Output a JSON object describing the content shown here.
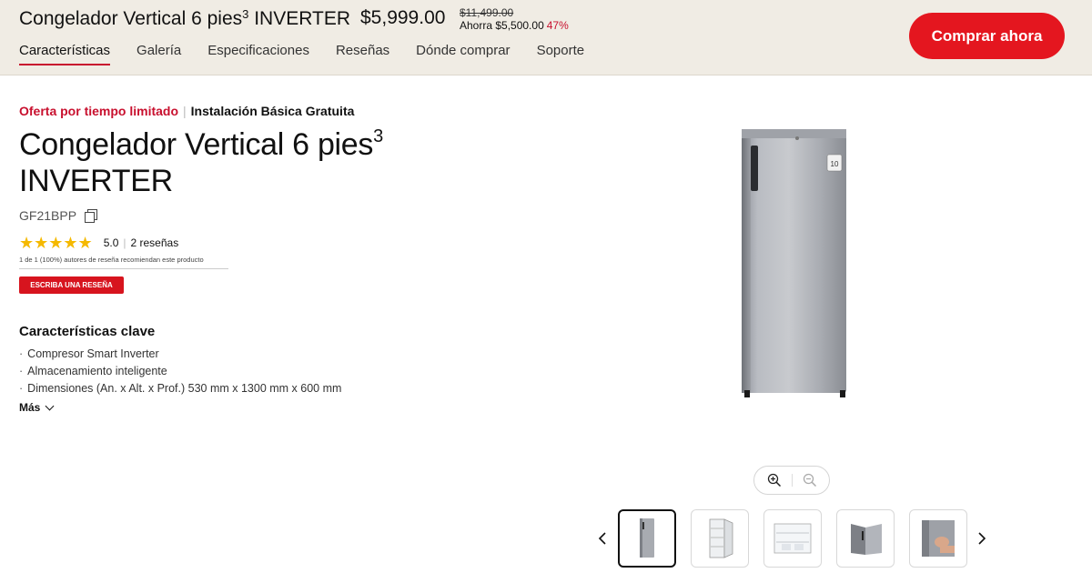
{
  "header": {
    "title": "Congelador Vertical 6 pies",
    "title_sup": "3",
    "title_suffix": " INVERTER",
    "price": "$5,999.00",
    "original_price": "$11,499.00",
    "savings": "Ahorra $5,500.00",
    "discount_pct": "47%",
    "buy_button": "Comprar ahora"
  },
  "nav": {
    "items": [
      "Características",
      "Galería",
      "Especificaciones",
      "Reseñas",
      "Dónde comprar",
      "Soporte"
    ],
    "active_index": 0
  },
  "product": {
    "offer_label": "Oferta por tiempo limitado",
    "install_label": "Instalación Básica Gratuita",
    "title_line1": "Congelador Vertical 6 pies",
    "title_sup": "3",
    "title_line2": "INVERTER",
    "model": "GF21BPP",
    "rating_value": "5.0",
    "rating_stars": "★★★★★",
    "review_count": "2 reseñas",
    "recommend_text": "1 de 1 (100%) autores de reseña recomiendan este producto",
    "write_review": "ESCRIBA UNA RESEÑA",
    "key_features_title": "Características clave",
    "features": [
      "Compresor Smart Inverter",
      "Almacenamiento inteligente",
      "Dimensiones (An. x Alt. x Prof.) 530 mm x 1300 mm x 600 mm"
    ],
    "more_label": "Más"
  },
  "gallery": {
    "thumbnails": [
      "freezer-front",
      "freezer-open-door",
      "freezer-interior",
      "freezer-side-angle",
      "freezer-hand-opening"
    ],
    "active_index": 0
  },
  "colors": {
    "accent_red": "#e4161f",
    "header_bg": "#f0ece4",
    "star": "#f5b900"
  }
}
